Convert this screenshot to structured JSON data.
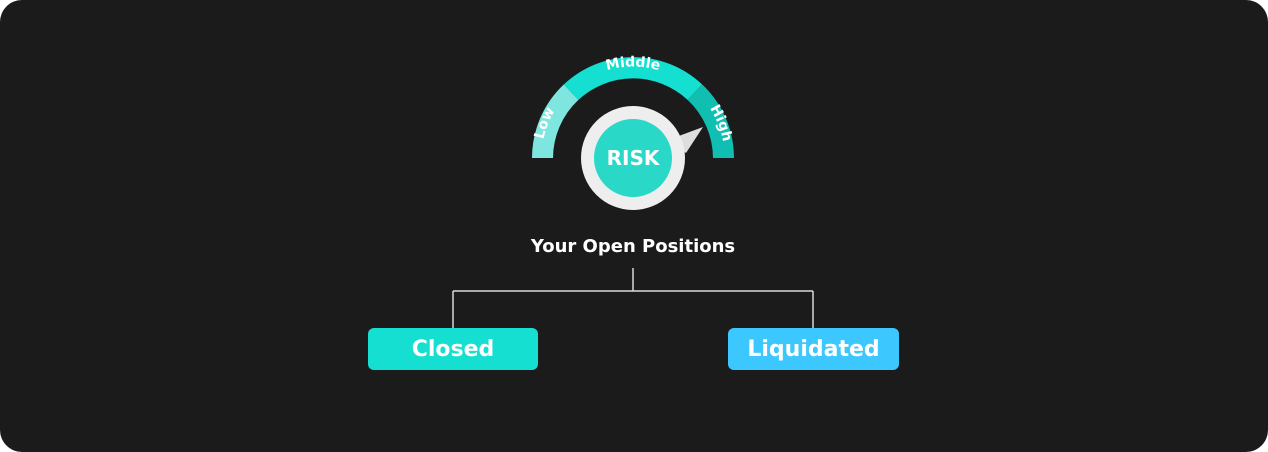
{
  "gauge": {
    "segments": [
      {
        "label": "Low",
        "color": "#7fe6df"
      },
      {
        "label": "Middle",
        "color": "#14dfd0"
      },
      {
        "label": "High",
        "color": "#11bfb2"
      }
    ],
    "center_label": "RISK",
    "ring_color": "#eeeeee",
    "center_color": "#2ad8c8"
  },
  "title": "Your Open Positions",
  "outcomes": [
    {
      "label": "Closed",
      "color": "#14dfd0"
    },
    {
      "label": "Liquidated",
      "color": "#3cc8ff"
    }
  ]
}
